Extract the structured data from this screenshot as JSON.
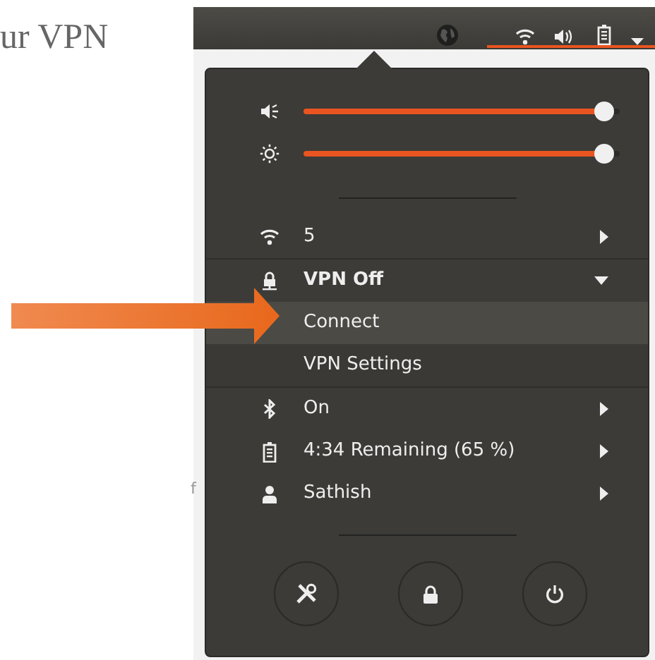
{
  "background_page": {
    "heading": "ur VPN",
    "fragment": "f"
  },
  "menu": {
    "sliders": [
      {
        "kind": "volume",
        "level": 0.98
      },
      {
        "kind": "brightness",
        "level": 0.98
      }
    ],
    "items": [
      {
        "kind": "wifi",
        "label": "5"
      },
      {
        "kind": "vpn",
        "label": "VPN Off",
        "expanded": true,
        "children": [
          {
            "label": "Connect",
            "selected": true
          },
          {
            "label": "VPN Settings",
            "selected": false
          }
        ]
      },
      {
        "kind": "bluetooth",
        "label": "On"
      },
      {
        "kind": "battery",
        "label": "4:34 Remaining (65 %)"
      },
      {
        "kind": "user",
        "label": "Sathish"
      }
    ],
    "actions": [
      {
        "kind": "settings"
      },
      {
        "kind": "lock"
      },
      {
        "kind": "power"
      }
    ]
  }
}
